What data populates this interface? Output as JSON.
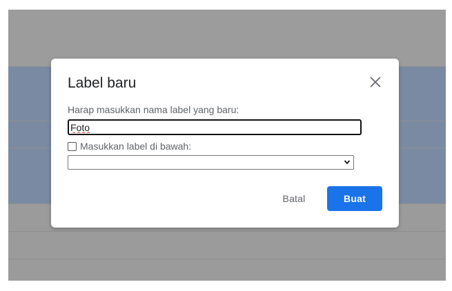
{
  "dialog": {
    "title": "Label baru",
    "prompt": "Harap masukkan nama label yang baru:",
    "name_value": "Foto",
    "nest_label": "Masukkan label di bawah:",
    "nest_checked": false,
    "parent_selected": "",
    "cancel_label": "Batal",
    "create_label": "Buat",
    "close_icon": "close-icon",
    "dropdown_icon": "chevron-down-icon"
  },
  "colors": {
    "overlay": "#9b9b9b",
    "selected_band": "#7b8aa3",
    "primary_button": "#1a73e8",
    "title_text": "#202124",
    "secondary_text": "#5f6368"
  }
}
